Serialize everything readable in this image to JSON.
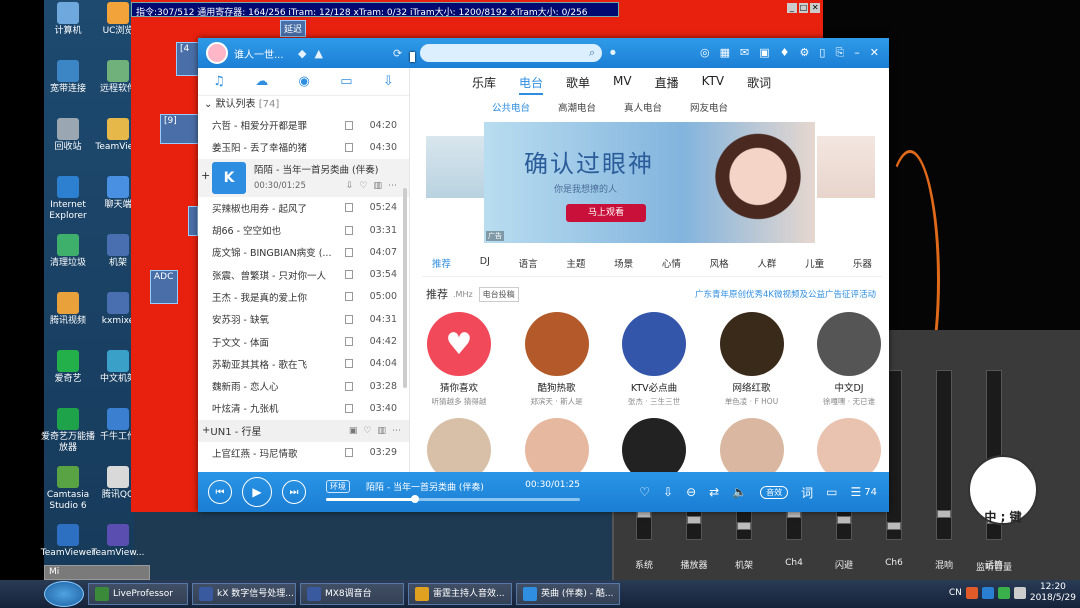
{
  "desktop": {
    "icons": [
      {
        "label": "计算机",
        "color": "#6fa8dc"
      },
      {
        "label": "UC浏览",
        "color": "#f2a33a"
      },
      {
        "label": "宽带连接",
        "color": "#3d86c6"
      },
      {
        "label": "远程软件",
        "color": "#6fb07b"
      },
      {
        "label": "回收站",
        "color": "#9aa7b3"
      },
      {
        "label": "TeamView",
        "color": "#e6b84a"
      },
      {
        "label": "Internet Explorer",
        "color": "#2d7fd0"
      },
      {
        "label": "聊天端",
        "color": "#4a90e2"
      },
      {
        "label": "清理垃圾",
        "color": "#3fb06b"
      },
      {
        "label": "机架",
        "color": "#4a6fb0"
      },
      {
        "label": "腾讯视频",
        "color": "#e9a23b"
      },
      {
        "label": "kxmixe",
        "color": "#4a6fb0"
      },
      {
        "label": "爱奇艺",
        "color": "#23b04a"
      },
      {
        "label": "中文机架",
        "color": "#3aa0c8"
      },
      {
        "label": "爱奇艺万能播放器",
        "color": "#1fa34a"
      },
      {
        "label": "千牛工作",
        "color": "#3a7fd0"
      },
      {
        "label": "Camtasia Studio 6",
        "color": "#5aa344"
      },
      {
        "label": "腾讯QQ",
        "color": "#d9d9d9"
      },
      {
        "label": "TeamViewer",
        "color": "#2d6fc0"
      },
      {
        "label": "TeamView...",
        "color": "#5a4fb0"
      }
    ]
  },
  "redapp": {
    "status": "指令:307/512 通用寄存器: 164/256 iTram: 12/128 xTram: 0/32 iTram大小: 1200/8192 xTram大小: 0/256",
    "boxes": [
      "延迟",
      "[4",
      "[9]",
      "[6]",
      "ADC"
    ]
  },
  "mini": {
    "label": "Mi"
  },
  "app": {
    "user": "谁人一世...",
    "search": {
      "placeholder": ""
    },
    "left_tabs": [
      "♫",
      "☁",
      "◉",
      "▭",
      "⇩"
    ],
    "list_title": "默认列表",
    "list_count": "[74]",
    "songs_top": [
      {
        "name": "六哲 - 相爱分开都是罪",
        "dur": "04:20"
      },
      {
        "name": "姜玉阳 - 丢了幸福的猪",
        "dur": "04:30"
      }
    ],
    "active": {
      "name": "陌陌 - 当年一首另类曲 (伴奏)",
      "time": "00:30/01:25",
      "badge": "K"
    },
    "songs": [
      {
        "name": "买辣椒也用券 - 起风了",
        "dur": "05:24"
      },
      {
        "name": "胡66 - 空空如也",
        "dur": "03:31"
      },
      {
        "name": "庞文锦 - BINGBIAN病变 (...",
        "dur": "04:07"
      },
      {
        "name": "张震、曾繁琪 - 只对你一人",
        "dur": "03:54"
      },
      {
        "name": "王杰 - 我是真的爱上你",
        "dur": "05:00"
      },
      {
        "name": "安苏羽 - 缺氧",
        "dur": "04:31"
      },
      {
        "name": "于文文 - 体面",
        "dur": "04:42"
      },
      {
        "name": "苏勒亚其其格 - 歌在飞",
        "dur": "04:04"
      },
      {
        "name": "魏新雨 - 恋人心",
        "dur": "03:28"
      },
      {
        "name": "叶炫清 - 九张机",
        "dur": "03:40"
      }
    ],
    "section2": "UN1 - 行星",
    "section2_song": {
      "name": "上官红燕 - 玛尼情歌",
      "dur": "03:29"
    },
    "top_nav": [
      "乐库",
      "电台",
      "歌单",
      "MV",
      "直播",
      "KTV",
      "歌词"
    ],
    "top_nav_active": 1,
    "sub_nav": [
      "公共电台",
      "高潮电台",
      "真人电台",
      "网友电台"
    ],
    "banner": {
      "title": "确认过眼神",
      "sub": "你是我想撩的人",
      "button": "马上观看",
      "ad": "广告"
    },
    "categories": [
      "推荐",
      "DJ",
      "语言",
      "主题",
      "场景",
      "心情",
      "风格",
      "人群",
      "儿童",
      "乐器"
    ],
    "rec": {
      "title": "推荐",
      "mhz": ".MHz",
      "tab": "电台投稿",
      "ad": "广东青年原创优秀4K微视频及公益广告征评活动"
    },
    "cards": [
      {
        "name": "猜你喜欢",
        "sub": "听猜越多 猜得越",
        "color": "#f2495a"
      },
      {
        "name": "酷狗热歌",
        "sub": "郑滨天 · 斯人是",
        "color": "#b45a2a"
      },
      {
        "name": "KTV必点曲",
        "sub": "张杰 · 三生三世",
        "color": "#3355aa"
      },
      {
        "name": "网络红歌",
        "sub": "单色凌 · F HOU",
        "color": "#3a2a1a"
      },
      {
        "name": "中文DJ",
        "sub": "徐嘎嘿 · 无已谁",
        "color": "#555"
      }
    ],
    "cards2_colors": [
      "#d8c0a8",
      "#e7b8a0",
      "#222",
      "#d9b7a0",
      "#e9c3b0"
    ],
    "player": {
      "tag": "环境",
      "song": "陌陌 - 当年一首另类曲 (伴奏)",
      "time": "00:30/01:25",
      "mode": "音效",
      "count": "74",
      "progress": 0.35
    }
  },
  "mixer": {
    "labels": [
      "系统",
      "播放器",
      "机架",
      "Ch4",
      "闪避",
      "Ch6",
      "混响",
      "话筒"
    ],
    "right_label": "监听音量"
  },
  "taskbar": {
    "tasks": [
      {
        "label": "LiveProfessor",
        "color": "#3a8a3a"
      },
      {
        "label": "kX 数字信号处理...",
        "color": "#3a5aa0"
      },
      {
        "label": "MX8调音台",
        "color": "#3a5aa0"
      },
      {
        "label": "雷霆主持人音效...",
        "color": "#e0a020"
      },
      {
        "label": "英曲 (伴奏) - 酷...",
        "color": "#2f8ee0"
      }
    ],
    "tray": {
      "lang": "CN",
      "time": "12:20",
      "date": "2018/5/29"
    }
  },
  "sticker": {
    "text": "中 ; 键"
  }
}
